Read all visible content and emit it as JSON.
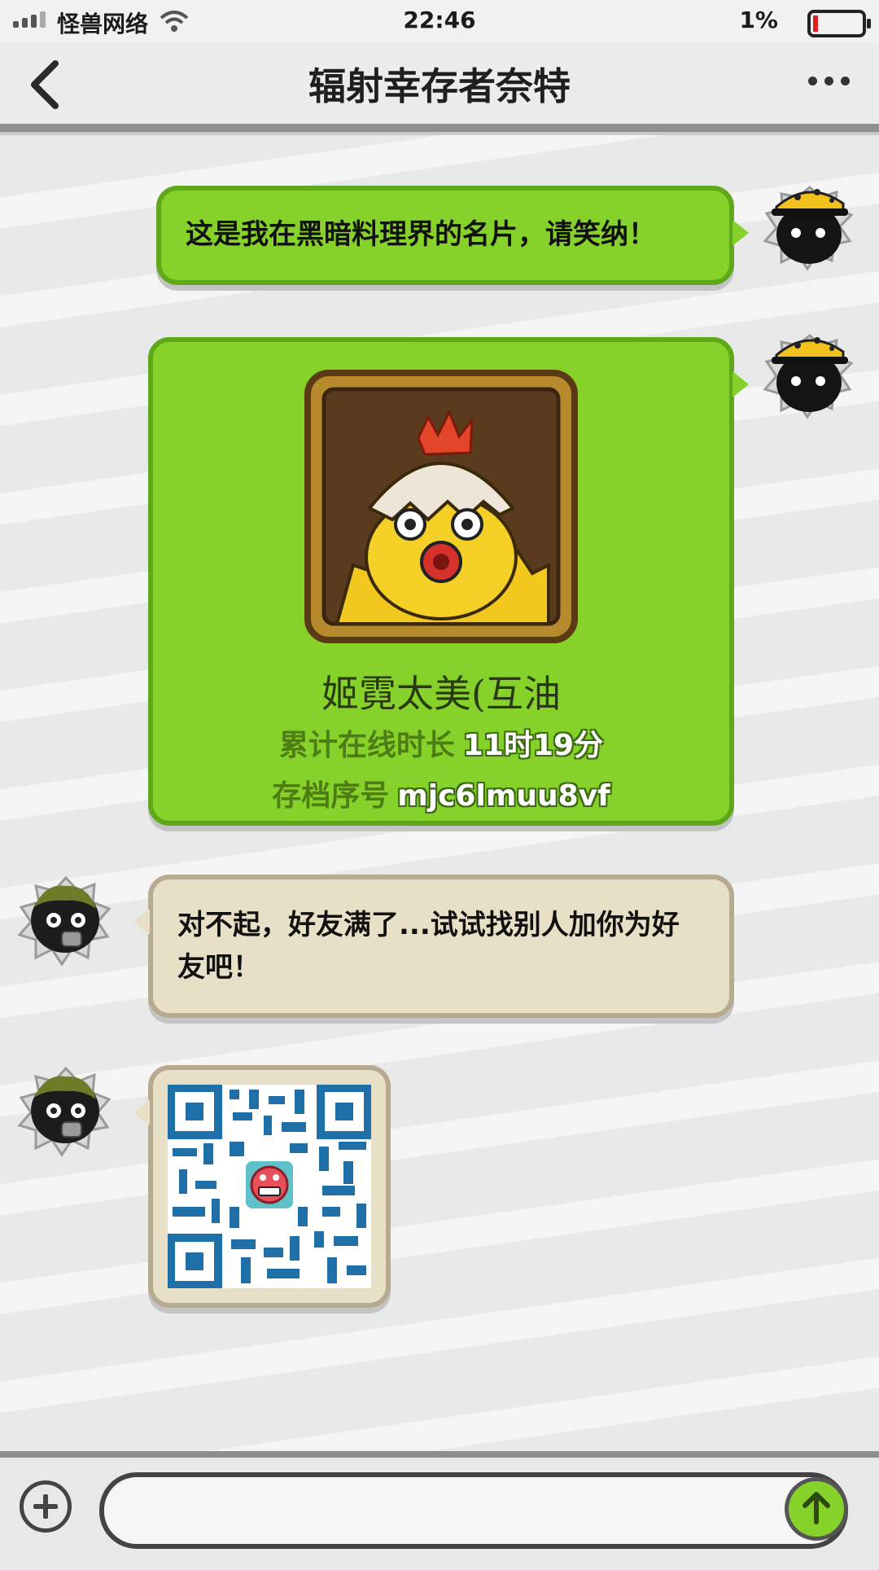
{
  "status_bar": {
    "carrier": "怪兽网络",
    "time": "22:46",
    "battery_percent": "1%",
    "battery_level": 0.01
  },
  "nav": {
    "title": "辐射幸存者奈特"
  },
  "messages": [
    {
      "from": "me",
      "type": "text",
      "text": "这是我在黑暗料理界的名片，请笑纳！"
    },
    {
      "from": "me",
      "type": "card",
      "card": {
        "name": "姬霓太美(互油",
        "online_label": "累计在线时长",
        "online_value": "11时19分",
        "save_label": "存档序号",
        "save_value": "mjc6lmuu8vf"
      }
    },
    {
      "from": "other",
      "type": "text",
      "text": "对不起，好友满了...试试找别人加你为好友吧！"
    },
    {
      "from": "other",
      "type": "qr-image"
    }
  ],
  "input": {
    "value": "",
    "placeholder": ""
  },
  "colors": {
    "out_bubble": "#86d22a",
    "in_bubble": "#e7dfc6",
    "qr_blue": "#1f6fa8"
  },
  "icons": [
    "signal-icon",
    "wifi-icon",
    "battery-icon",
    "back-icon",
    "more-icon",
    "plus-icon",
    "send-arrow-icon",
    "avatar-me-icon",
    "avatar-other-icon",
    "qr-code-icon",
    "chick-portrait-icon"
  ]
}
